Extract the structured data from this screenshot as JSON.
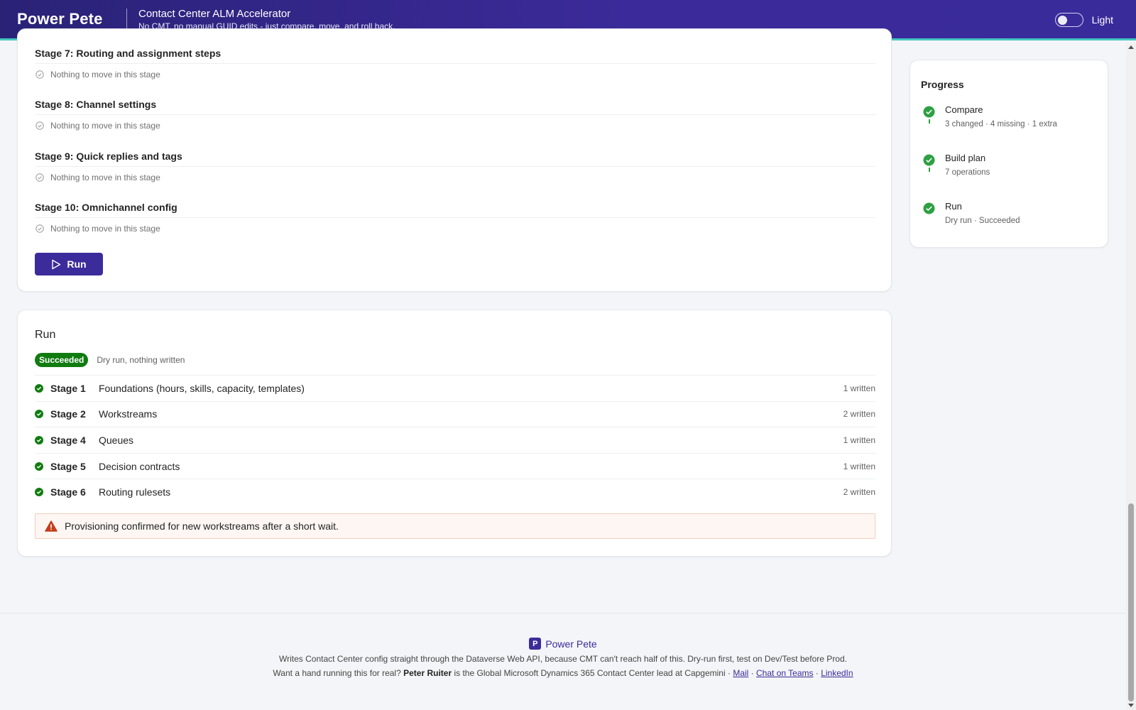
{
  "header": {
    "brand": "Power Pete",
    "title": "Contact Center ALM Accelerator",
    "subtitle": "No CMT, no manual GUID edits - just compare, move, and roll back.",
    "theme_label": "Light"
  },
  "stages": [
    {
      "title": "Stage 7: Routing and assignment steps",
      "empty": "Nothing to move in this stage"
    },
    {
      "title": "Stage 8: Channel settings",
      "empty": "Nothing to move in this stage"
    },
    {
      "title": "Stage 9: Quick replies and tags",
      "empty": "Nothing to move in this stage"
    },
    {
      "title": "Stage 10: Omnichannel config",
      "empty": "Nothing to move in this stage"
    }
  ],
  "run_button": "Run",
  "run": {
    "title": "Run",
    "badge": "Succeeded",
    "note": "Dry run, nothing written",
    "rows": [
      {
        "stage": "Stage 1",
        "desc": "Foundations (hours, skills, capacity, templates)",
        "count": "1 written"
      },
      {
        "stage": "Stage 2",
        "desc": "Workstreams",
        "count": "2 written"
      },
      {
        "stage": "Stage 4",
        "desc": "Queues",
        "count": "1 written"
      },
      {
        "stage": "Stage 5",
        "desc": "Decision contracts",
        "count": "1 written"
      },
      {
        "stage": "Stage 6",
        "desc": "Routing rulesets",
        "count": "2 written"
      }
    ],
    "warning": "Provisioning confirmed for new workstreams after a short wait."
  },
  "progress": {
    "title": "Progress",
    "steps": [
      {
        "label": "Compare",
        "sub": "3 changed · 4 missing · 1 extra"
      },
      {
        "label": "Build plan",
        "sub": "7 operations"
      },
      {
        "label": "Run",
        "sub": "Dry run · Succeeded"
      }
    ]
  },
  "footer": {
    "brand": "Power Pete",
    "logo_letter": "P",
    "line1": "Writes Contact Center config straight through the Dataverse Web API, because CMT can't reach half of this. Dry-run first, test on Dev/Test before Prod.",
    "line2_prefix": "Want a hand running this for real?",
    "line2_name": "Peter Ruiter",
    "line2_suffix": "is the Global Microsoft Dynamics 365 Contact Center lead at Capgemini ·",
    "links": [
      "Mail",
      "Chat on Teams",
      "LinkedIn"
    ]
  },
  "colors": {
    "header_bg": "#3b2a99",
    "accent_teal": "#43c7bf",
    "primary": "#3c2b9a",
    "success": "#107c10",
    "warning": "#d83b01"
  }
}
